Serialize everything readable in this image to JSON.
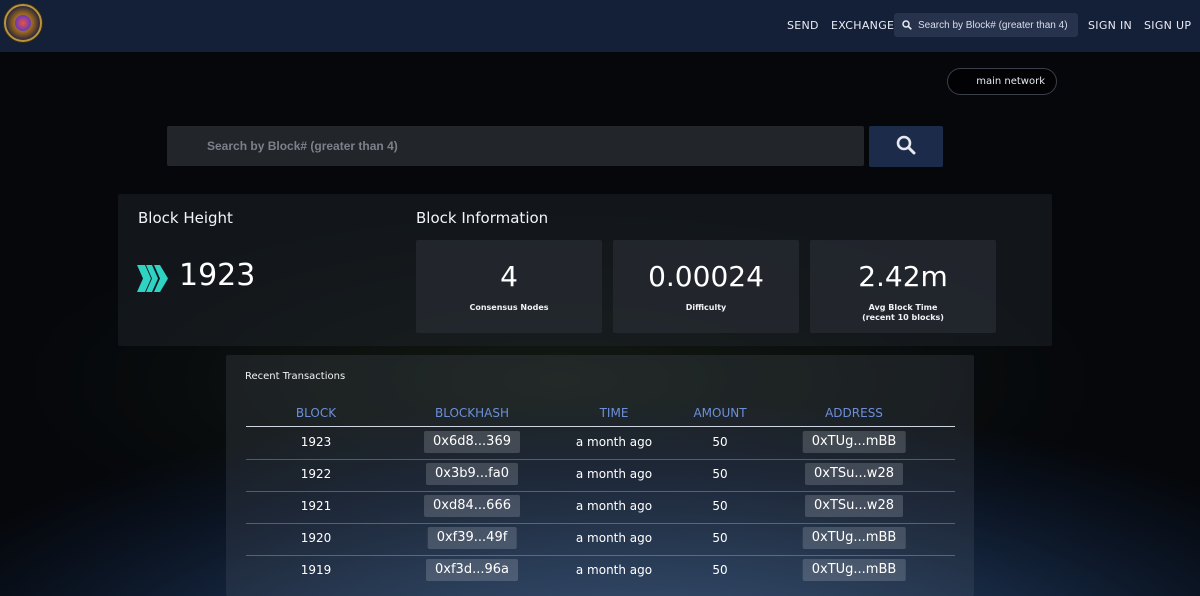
{
  "navbar": {
    "links": {
      "send": "SEND",
      "exchange": "EXCHANGE",
      "sign_in": "SIGN IN",
      "sign_up": "SIGN UP"
    },
    "search_placeholder": "Search by Block# (greater than 4)"
  },
  "network": {
    "label": "main network"
  },
  "main_search": {
    "placeholder": "Search by Block# (greater than 4)"
  },
  "block_height": {
    "title": "Block Height",
    "value": "1923"
  },
  "block_info": {
    "title": "Block Information",
    "cards": [
      {
        "value": "4",
        "label": "Consensus Nodes",
        "sublabel": ""
      },
      {
        "value": "0.00024",
        "label": "Difficulty",
        "sublabel": ""
      },
      {
        "value": "2.42m",
        "label": "Avg Block Time",
        "sublabel": "(recent 10 blocks)"
      }
    ]
  },
  "transactions": {
    "title": "Recent Transactions",
    "columns": [
      "BLOCK",
      "BLOCKHASH",
      "TIME",
      "AMOUNT",
      "ADDRESS"
    ],
    "rows": [
      {
        "block": "1923",
        "hash": "0x6d8...369",
        "time": "a month ago",
        "amount": "50",
        "address": "0xTUg...mBB"
      },
      {
        "block": "1922",
        "hash": "0x3b9...fa0",
        "time": "a month ago",
        "amount": "50",
        "address": "0xTSu...w28"
      },
      {
        "block": "1921",
        "hash": "0xd84...666",
        "time": "a month ago",
        "amount": "50",
        "address": "0xTSu...w28"
      },
      {
        "block": "1920",
        "hash": "0xf39...49f",
        "time": "a month ago",
        "amount": "50",
        "address": "0xTUg...mBB"
      },
      {
        "block": "1919",
        "hash": "0xf3d...96a",
        "time": "a month ago",
        "amount": "50",
        "address": "0xTUg...mBB"
      }
    ]
  },
  "colors": {
    "navbar_bg": "#141f38",
    "accent_teal": "#2fd3c3",
    "column_header": "#6d8fd8",
    "search_button_bg": "#1d2b4a"
  },
  "icons": [
    "logo",
    "search-icon",
    "hive-logo-icon"
  ]
}
